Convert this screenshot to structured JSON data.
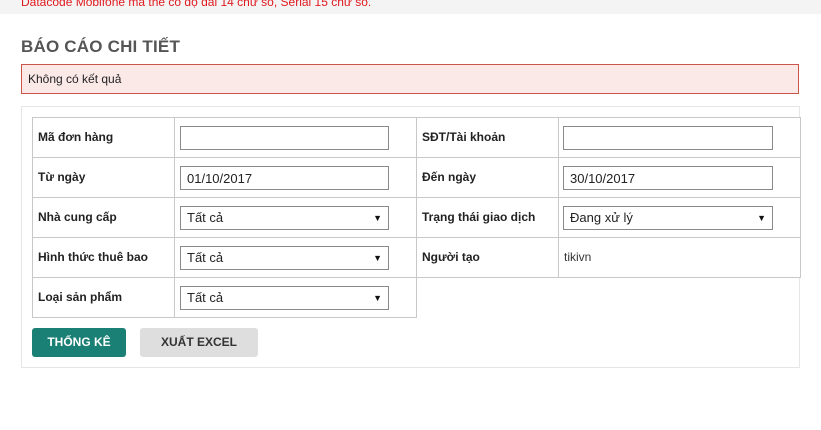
{
  "notice": "Datacode Mobifone mã thẻ có độ dài 14 chữ số, Serial 15 chữ số.",
  "page_title": "BÁO CÁO CHI TIẾT",
  "alert_text": "Không có kết quả",
  "form": {
    "order_id": {
      "label": "Mã đơn hàng",
      "value": ""
    },
    "phone_account": {
      "label": "SĐT/Tài khoản",
      "value": ""
    },
    "from_date": {
      "label": "Từ ngày",
      "value": "01/10/2017"
    },
    "to_date": {
      "label": "Đến ngày",
      "value": "30/10/2017"
    },
    "provider": {
      "label": "Nhà cung cấp",
      "value": "Tất cả"
    },
    "transaction_status": {
      "label": "Trạng thái giao dịch",
      "value": "Đang xử lý"
    },
    "subscription_type": {
      "label": "Hình thức thuê bao",
      "value": "Tất cả"
    },
    "creator": {
      "label": "Người tạo",
      "value": "tikivn"
    },
    "product_type": {
      "label": "Loại sản phẩm",
      "value": "Tất cả"
    }
  },
  "buttons": {
    "statistics": "THỐNG KÊ",
    "export_excel": "XUẤT EXCEL"
  },
  "colors": {
    "primary_button": "#1a7f74",
    "alert_border": "#c9554c",
    "alert_background": "#fbe9e8",
    "notice_text": "#e0191e"
  },
  "icons": {
    "dropdown_caret": "▼"
  }
}
